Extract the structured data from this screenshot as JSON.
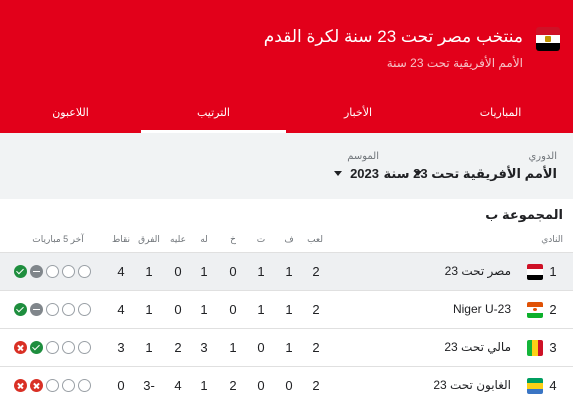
{
  "header": {
    "title": "منتخب مصر تحت 23 سنة لكرة القدم",
    "subtitle": "الأمم الأفريقية تحت 23 سنة",
    "flag_colors": [
      "#ce1126",
      "#ffffff",
      "#000000"
    ]
  },
  "tabs": [
    {
      "label": "المباريات"
    },
    {
      "label": "الأخبار"
    },
    {
      "label": "الترتيب",
      "active": true
    },
    {
      "label": "اللاعبون"
    }
  ],
  "filters": {
    "league_label": "الدوري",
    "league_value": "الأمم الأفريقية تحت 23 سنة",
    "season_label": "الموسم",
    "season_value": "2023"
  },
  "group": {
    "title": "المجموعة ب",
    "columns": {
      "club": "النادي",
      "played": "لعب",
      "won": "ف",
      "drawn": "ت",
      "lost": "خ",
      "for": "له",
      "against": "عليه",
      "diff": "الفرق",
      "points": "نقاط",
      "last5": "آخر 5 مباريات"
    },
    "rows": [
      {
        "rank": "1",
        "team": "مصر تحت 23",
        "flag": "egypt",
        "played": "2",
        "won": "1",
        "drawn": "1",
        "lost": "0",
        "for": "1",
        "against": "0",
        "diff": "1",
        "points": "4",
        "form": [
          "win",
          "draw",
          "empty",
          "empty",
          "empty"
        ],
        "highlight": true
      },
      {
        "rank": "2",
        "team": "Niger U-23",
        "flag": "niger",
        "played": "2",
        "won": "1",
        "drawn": "1",
        "lost": "0",
        "for": "1",
        "against": "0",
        "diff": "1",
        "points": "4",
        "form": [
          "win",
          "draw",
          "empty",
          "empty",
          "empty"
        ],
        "highlight": false
      },
      {
        "rank": "3",
        "team": "مالي تحت 23",
        "flag": "mali",
        "played": "2",
        "won": "1",
        "drawn": "0",
        "lost": "1",
        "for": "3",
        "against": "2",
        "diff": "1",
        "points": "3",
        "form": [
          "loss",
          "win",
          "empty",
          "empty",
          "empty"
        ],
        "highlight": false
      },
      {
        "rank": "4",
        "team": "الغابون تحت 23",
        "flag": "gabon",
        "played": "2",
        "won": "0",
        "drawn": "0",
        "lost": "2",
        "for": "1",
        "against": "4",
        "diff": "-3",
        "points": "0",
        "form": [
          "loss",
          "loss",
          "empty",
          "empty",
          "empty"
        ],
        "highlight": false
      }
    ]
  }
}
